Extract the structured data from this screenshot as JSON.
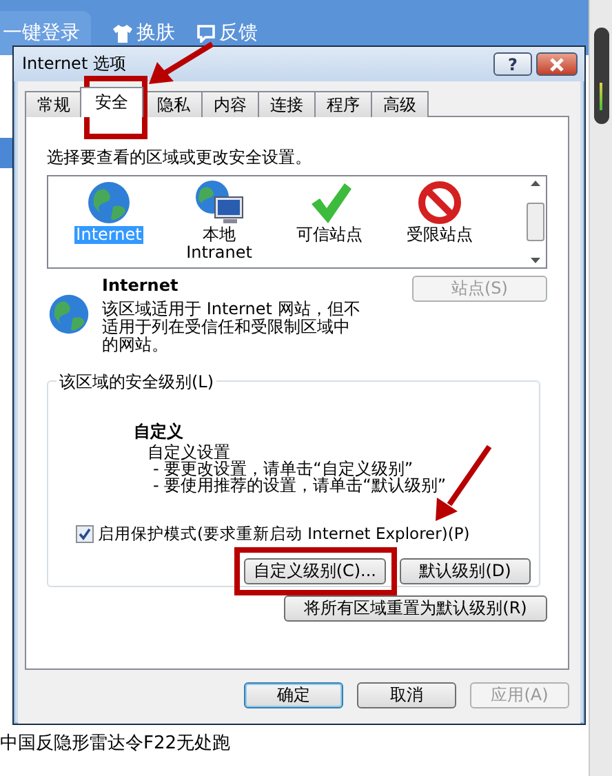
{
  "background": {
    "login_tab": "一键登录",
    "links": [
      {
        "kind": "shirt",
        "label": "换肤"
      },
      {
        "kind": "bubble",
        "label": "反馈"
      }
    ],
    "headline": "中国反隐形雷达令F22无处跑"
  },
  "dialog": {
    "title": "Internet 选项",
    "help": "?",
    "tabs": [
      {
        "label": "常规",
        "selected": false
      },
      {
        "label": "安全",
        "selected": true
      },
      {
        "label": "隐私",
        "selected": false
      },
      {
        "label": "内容",
        "selected": false
      },
      {
        "label": "连接",
        "selected": false
      },
      {
        "label": "程序",
        "selected": false
      },
      {
        "label": "高级",
        "selected": false
      }
    ],
    "intro": "选择要查看的区域或更改安全设置。",
    "zones": [
      {
        "kind": "globe",
        "lines": [
          "Internet"
        ],
        "selected": true
      },
      {
        "kind": "intranet",
        "lines": [
          "本地",
          "Intranet"
        ],
        "selected": false
      },
      {
        "kind": "trusted",
        "lines": [
          "可信站点"
        ],
        "selected": false
      },
      {
        "kind": "restricted",
        "lines": [
          "受限站点"
        ],
        "selected": false
      }
    ],
    "zone_info": {
      "title": "Internet",
      "description": "该区域适用于 Internet 网站，但不适用于列在受信任和受限制区域中的网站。",
      "sites_button": {
        "label": "站点(S)",
        "disabled": true
      }
    },
    "security_level": {
      "title": "该区域的安全级别(L)",
      "level_name": "自定义",
      "lines": [
        "自定义设置",
        "- 要更改设置，请单击“自定义级别”",
        "- 要使用推荐的设置，请单击“默认级别”"
      ],
      "protected_mode": {
        "label": "启用保护模式(要求重新启动 Internet Explorer)(P)",
        "checked": true
      },
      "buttons": [
        {
          "label": "自定义级别(C)...",
          "disabled": false
        },
        {
          "label": "默认级别(D)",
          "disabled": false
        }
      ]
    },
    "reset_button": "将所有区域重置为默认级别(R)",
    "footer": [
      {
        "label": "确定",
        "kind": "default",
        "disabled": false
      },
      {
        "label": "取消",
        "kind": "normal",
        "disabled": false
      },
      {
        "label": "应用(A)",
        "kind": "normal",
        "disabled": true
      }
    ]
  }
}
